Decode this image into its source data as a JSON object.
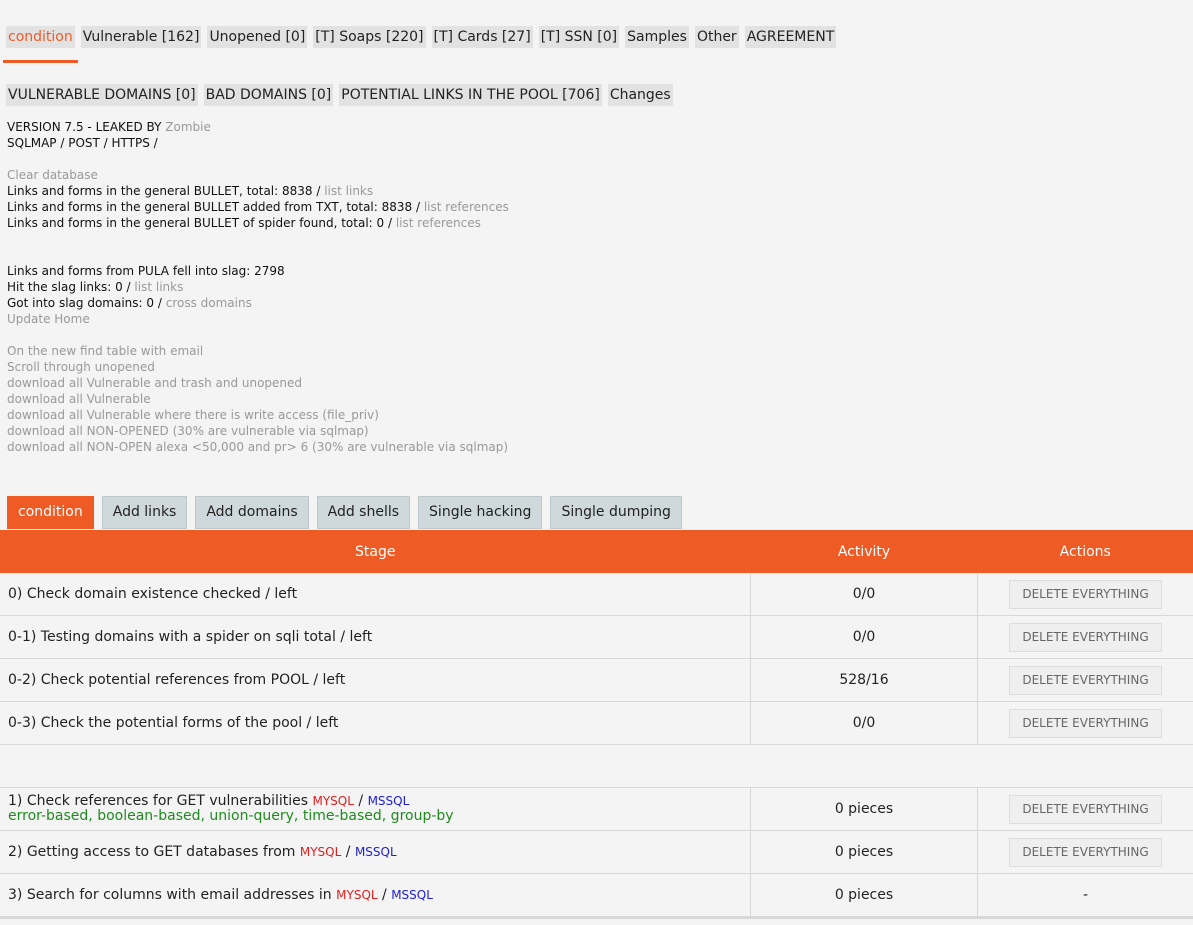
{
  "top_tabs": [
    {
      "label": "condition",
      "active": true
    },
    {
      "label": "Vulnerable [162]"
    },
    {
      "label": "Unopened [0]"
    },
    {
      "label": "[T] Soaps [220]"
    },
    {
      "label": "[T] Cards [27]"
    },
    {
      "label": "[T] SSN [0]"
    },
    {
      "label": "Samples"
    },
    {
      "label": "Other"
    },
    {
      "label": "AGREEMENT"
    }
  ],
  "sub_tabs": [
    {
      "label": "VULNERABLE DOMAINS [0]"
    },
    {
      "label": "BAD DOMAINS [0]"
    },
    {
      "label": "POTENTIAL LINKS IN THE POOL [706]"
    },
    {
      "label": "Changes"
    }
  ],
  "info": {
    "version_prefix": "VERSION 7.5 - LEAKED BY",
    "version_author": "Zombie",
    "mode": "SQLMAP / POST / HTTPS /",
    "clear_db": "Clear database",
    "general_total_text": "Links and forms in the general BULLET, total: 8838 /",
    "general_total_link": "list links",
    "txt_total_text": "Links and forms in the general BULLET added from TXT, total: 8838 /",
    "txt_total_link": "list references",
    "spider_total_text": "Links and forms in the general BULLET of spider found, total: 0 /",
    "spider_total_link": "list references",
    "pula_slag": "Links and forms from PULA fell into slag: 2798",
    "hit_slag_text": "Hit the slag links: 0 /",
    "hit_slag_link": "list links",
    "slag_domains_text": "Got into slag domains: 0 /",
    "slag_domains_link": "cross domains",
    "update_home": "Update Home",
    "links2": [
      "On the new find table with email",
      "Scroll through unopened",
      "download all Vulnerable and trash and unopened",
      "download all Vulnerable",
      "download all Vulnerable where there is write access (file_priv)",
      "download all NON-OPENED (30% are vulnerable via sqlmap)",
      "download all NON-OPEN alexa <50,000 and pr> 6 (30% are vulnerable via sqlmap)"
    ]
  },
  "action_tabs": [
    {
      "label": "condition",
      "active": true
    },
    {
      "label": "Add links"
    },
    {
      "label": "Add domains"
    },
    {
      "label": "Add shells"
    },
    {
      "label": "Single hacking"
    },
    {
      "label": "Single dumping"
    }
  ],
  "table": {
    "headers": {
      "stage": "Stage",
      "activity": "Activity",
      "actions": "Actions"
    },
    "delete_label": "DELETE EVERYTHING",
    "rows_a": [
      {
        "stage": "0) Check domain existence checked / left",
        "activity": "0/0"
      },
      {
        "stage": "0-1) Testing domains with a spider on sqli total / left",
        "activity": "0/0"
      },
      {
        "stage": "0-2) Check potential references from POOL / left",
        "activity": "528/16"
      },
      {
        "stage": "0-3) Check the potential forms of the pool / left",
        "activity": "0/0"
      }
    ],
    "row1": {
      "stage": "1) Check references for GET vulnerabilities",
      "mysql": "MYSQL",
      "sep": "/",
      "mssql": "MSSQL",
      "techniques": "error-based, boolean-based, union-query, time-based, group-by",
      "activity": "0 pieces"
    },
    "row2": {
      "stage": "2) Getting access to GET databases from",
      "mysql": "MYSQL",
      "sep": "/",
      "mssql": "MSSQL",
      "activity": "0 pieces"
    },
    "row3": {
      "stage": "3) Search for columns with email addresses in",
      "mysql": "MYSQL",
      "sep": "/",
      "mssql": "MSSQL",
      "activity": "0 pieces",
      "actions": "-"
    }
  },
  "colors": {
    "accent": "#ef5b25",
    "mysql": "#e02020",
    "mssql": "#2020d0",
    "technique": "#1f8a1f"
  }
}
